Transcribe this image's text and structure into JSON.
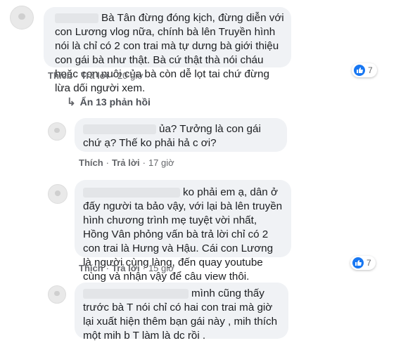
{
  "comments": [
    {
      "text": "Bà Tân đừng đóng kịch, đừng diễn với con Lương vlog nữa, chính bà lên Truyền hình nói là chỉ có 2 con trai mà tự dưng bà giới thiệu con gái bà như thật. Bà cứ thật thà nói cháu hoặc con nuôi của bà còn dễ lọt tai chứ đừng lừa dối người xem.",
      "like": "Thích",
      "reply": "Trả lời",
      "time": "20 giờ",
      "reaction_count": "7"
    },
    {
      "text": "ủa? Tưởng là con gái chứ ạ? Thế ko phải hả c ơi?",
      "like": "Thích",
      "reply": "Trả lời",
      "time": "17 giờ"
    },
    {
      "text": "ko phải em ạ, dân ở đấy người ta bảo vậy, với lại bà lên truyền hình chương trình mẹ tuyệt vời nhất, Hồng Vân phỏng vấn bà trả lời chỉ có 2 con trai là Hưng và Hậu. Cái con Lương là người cùng làng, đến quay youtube cùng và nhận vậy để câu view thôi.",
      "like": "Thích",
      "reply": "Trả lời",
      "time": "15 giờ",
      "reaction_count": "7"
    },
    {
      "text": "mình cũng thấy trước bà T nói chỉ có hai con trai mà giờ lại xuất hiện thêm bạn gái này , mih thích một mih b T làm là dc rồi ."
    }
  ],
  "replies_toggle": "Ẩn 13 phản hồi",
  "colors": {
    "accent": "#1877f2",
    "bubble": "#f0f2f5"
  }
}
